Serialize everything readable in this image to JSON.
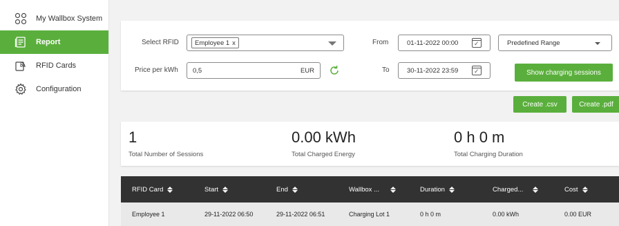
{
  "sidebar": {
    "items": [
      {
        "label": "My Wallbox System",
        "icon": "dashboard-grid-icon",
        "active": false
      },
      {
        "label": "Report",
        "icon": "report-document-icon",
        "active": true
      },
      {
        "label": "RFID Cards",
        "icon": "rfid-card-icon",
        "active": false
      },
      {
        "label": "Configuration",
        "icon": "gear-icon",
        "active": false
      }
    ]
  },
  "filters": {
    "rfid_label": "Select RFID",
    "rfid_chip": "Employee 1",
    "rfid_chip_remove": "x",
    "price_label": "Price per kWh",
    "price_value": "0,5",
    "price_unit": "EUR",
    "from_label": "From",
    "from_value": "01-11-2022 00:00",
    "to_label": "To",
    "to_value": "30-11-2022 23:59",
    "range_value": "Predefined Range",
    "show_button": "Show charging sessions"
  },
  "exports": {
    "csv": "Create .csv",
    "pdf": "Create .pdf"
  },
  "stats": {
    "sessions_value": "1",
    "sessions_label": "Total Number of Sessions",
    "energy_value": "0.00 kWh",
    "energy_label": "Total Charged Energy",
    "duration_value": "0 h 0 m",
    "duration_label": "Total Charging Duration"
  },
  "table": {
    "headers": [
      "RFID Card",
      "Start",
      "End",
      "Wallbox ...",
      "Duration",
      "Charged...",
      "Cost"
    ],
    "rows": [
      [
        "Employee 1",
        "29-11-2022 06:50",
        "29-11-2022 06:51",
        "Charging Lot 1",
        "0 h 0 m",
        "0.00 kWh",
        "0.00 EUR"
      ]
    ]
  },
  "colors": {
    "accent": "#5aaf3c",
    "table_header": "#323232"
  }
}
